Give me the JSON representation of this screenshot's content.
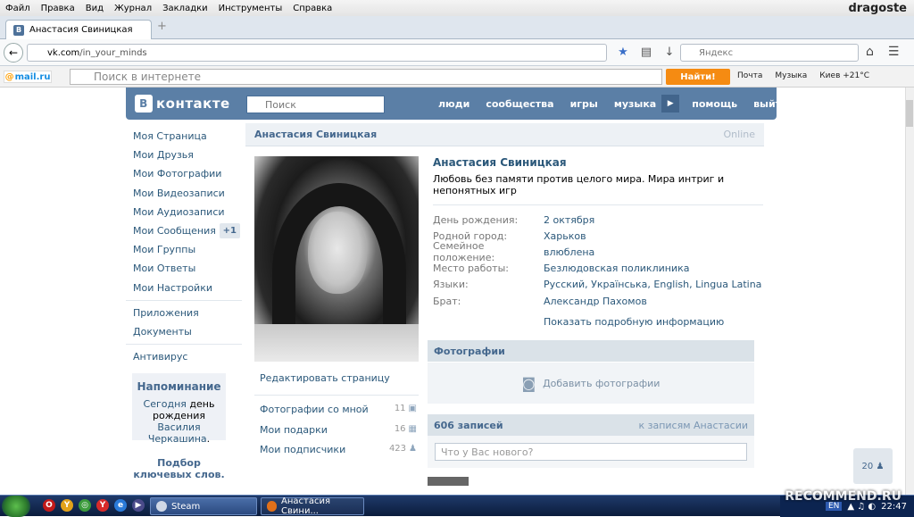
{
  "menubar": {
    "items": [
      "Файл",
      "Правка",
      "Вид",
      "Журнал",
      "Закладки",
      "Инструменты",
      "Справка"
    ],
    "window_title": "dragoste"
  },
  "tab": {
    "title": "Анастасия Свиницкая",
    "favicon": "В",
    "new_tab": "+"
  },
  "url": {
    "domain": "vk.com",
    "path": "/in_your_minds"
  },
  "yandex": {
    "placeholder": "Яндекс"
  },
  "mailbar": {
    "logo": "mail.ru",
    "search_placeholder": "Поиск в интернете",
    "find_button": "Найти!",
    "mail": "Почта",
    "music": "Музыка",
    "weather": "Киев +21°C"
  },
  "vk": {
    "logo": "контакте",
    "logo_icon": "В",
    "search_placeholder": "Поиск",
    "nav": [
      "люди",
      "сообщества",
      "игры",
      "музыка",
      "помощь",
      "выйти"
    ]
  },
  "left_menu": {
    "items": [
      "Моя Страница",
      "Мои Друзья",
      "Мои Фотографии",
      "Мои Видеозаписи",
      "Мои Аудиозаписи",
      "Мои Сообщения",
      "Мои Группы",
      "Мои Ответы",
      "Мои Настройки"
    ],
    "messages_badge": "+1",
    "apps": "Приложения",
    "docs": "Документы",
    "antivirus": "Антивирус",
    "reminder_title": "Напоминание",
    "reminder_today": "Сегодня",
    "reminder_text": "день рождения",
    "reminder_name1": "Василия",
    "reminder_name2": "Черкашина",
    "seo": "Подбор ключевых слов."
  },
  "profile": {
    "header_name": "Анастасия Свиницкая",
    "online": "Online",
    "name": "Анастасия Свиницкая",
    "status": "Любовь без памяти против целого мира. Мира интриг и непонятных игр",
    "rows": [
      {
        "k": "День рождения:",
        "v": "2 октября"
      },
      {
        "k": "Родной город:",
        "v": "Харьков"
      },
      {
        "k": "Семейное положение:",
        "v": "влюблена"
      },
      {
        "k": "Место работы:",
        "v": "Безлюдовская поликлиника"
      },
      {
        "k": "Языки:",
        "v": "Русский, Українська, English, Lingua Latina"
      },
      {
        "k": "Брат:",
        "v": "Александр Пахомов"
      }
    ],
    "more": "Показать подробную информацию",
    "edit": "Редактировать страницу",
    "photos_with_me": "Фотографии со мной",
    "photos_with_me_count": "11",
    "gifts": "Мои подарки",
    "gifts_count": "16",
    "subscribers": "Мои подписчики",
    "subscribers_count": "423",
    "photos_section": "Фотографии",
    "add_photos": "Добавить фотографии",
    "wall_count": "606 записей",
    "wall_link": "к записям Анастасии",
    "wall_placeholder": "Что у Вас нового?",
    "fab": "20"
  },
  "taskbar": {
    "steam": "Steam",
    "firefox": "Анастасия Свини...",
    "lang": "EN",
    "time": "22:47"
  },
  "watermark": "RECOMMEND.RU"
}
